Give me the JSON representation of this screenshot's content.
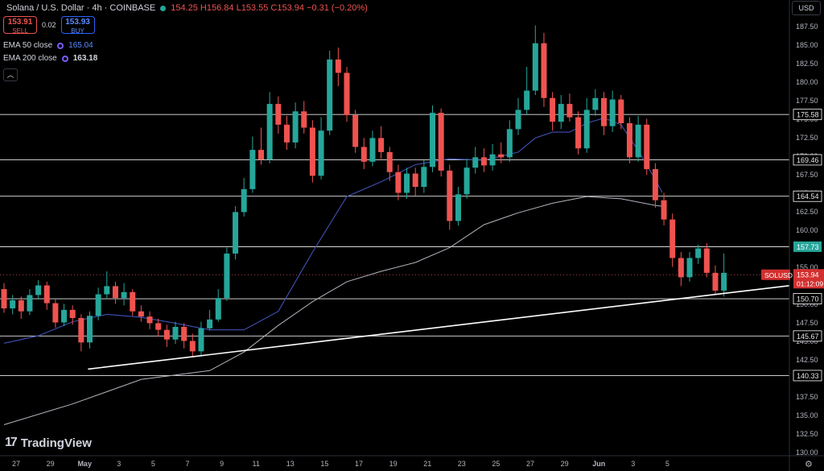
{
  "header": {
    "title": "Solana / U.S. Dollar · 4h · COINBASE",
    "ohlc": "154.25 H156.84 L153.55 C153.94 −0.31 (−0.20%)"
  },
  "trade": {
    "sell_price": "153.91",
    "sell_label": "SELL",
    "spread": "0.02",
    "buy_price": "153.93",
    "buy_label": "BUY"
  },
  "indicators": [
    {
      "name": "EMA 50 close",
      "value": "165.04",
      "color": "#3f51b5"
    },
    {
      "name": "EMA 200 close",
      "value": "163.18",
      "color": "#b2b5be"
    }
  ],
  "currency": "USD",
  "brand": "TradingView",
  "icons": [
    "settings-gear-icon",
    "collapse-chevron-icon",
    "tradingview-logo-icon"
  ],
  "colors": {
    "up": "#26a69a",
    "down": "#ef5350",
    "ema50": "#3f51b5",
    "ema200": "#b2b5be",
    "support": "#ffffff"
  },
  "chart_data": {
    "type": "candlestick",
    "symbol": "SOLUSD",
    "timeframe": "4h",
    "y_ticks": [
      "130.00",
      "132.50",
      "135.00",
      "137.50",
      "140.00",
      "142.50",
      "145.00",
      "147.50",
      "150.00",
      "152.50",
      "155.00",
      "157.50",
      "160.00",
      "162.50",
      "165.00",
      "167.50",
      "170.00",
      "172.50",
      "175.00",
      "177.50",
      "180.00",
      "182.50",
      "185.00",
      "187.50"
    ],
    "ylim": [
      129.5,
      189.5
    ],
    "x_ticks": [
      "27",
      "29",
      "May",
      "3",
      "5",
      "7",
      "9",
      "11",
      "13",
      "15",
      "17",
      "19",
      "21",
      "23",
      "25",
      "27",
      "29",
      "Jun",
      "3",
      "5"
    ],
    "price_lines": [
      {
        "label": "175.58",
        "value": 175.58,
        "highlight": false
      },
      {
        "label": "169.46",
        "value": 169.46,
        "highlight": false
      },
      {
        "label": "164.54",
        "value": 164.54,
        "highlight": false
      },
      {
        "label": "157.73",
        "value": 157.73,
        "highlight": true
      },
      {
        "label": "150.70",
        "value": 150.7,
        "highlight": false
      },
      {
        "label": "145.67",
        "value": 145.67,
        "highlight": false
      },
      {
        "label": "140.33",
        "value": 140.33,
        "highlight": false
      }
    ],
    "current": {
      "symbol": "SOLUSD",
      "price": "153.94",
      "countdown": "01:12:09",
      "value": 153.94
    },
    "trendline": {
      "from": {
        "day": 4.9,
        "price": 141.2
      },
      "to": {
        "day": 40.0,
        "price": 152.2
      }
    },
    "ema50_path": [
      [
        0,
        144.7
      ],
      [
        2,
        145.7
      ],
      [
        4,
        147.6
      ],
      [
        6,
        148.6
      ],
      [
        8,
        148.2
      ],
      [
        10,
        147.4
      ],
      [
        12,
        146.5
      ],
      [
        14,
        146.5
      ],
      [
        16,
        149.0
      ],
      [
        18,
        157.0
      ],
      [
        20,
        164.5
      ],
      [
        22,
        166.5
      ],
      [
        24,
        168.8
      ],
      [
        25,
        169.2
      ],
      [
        26,
        169.6
      ],
      [
        28,
        169.4
      ],
      [
        30,
        170.5
      ],
      [
        31,
        172.4
      ],
      [
        32,
        173.2
      ],
      [
        33,
        173.2
      ],
      [
        34,
        174.4
      ],
      [
        35,
        175.1
      ],
      [
        36,
        174.2
      ],
      [
        37,
        170.7
      ],
      [
        38,
        166.8
      ],
      [
        38.4,
        165.04
      ]
    ],
    "ema200_path": [
      [
        0,
        133.7
      ],
      [
        4,
        136.5
      ],
      [
        8,
        139.8
      ],
      [
        12,
        141.0
      ],
      [
        14,
        143.5
      ],
      [
        16,
        147.1
      ],
      [
        18,
        150.3
      ],
      [
        20,
        153.0
      ],
      [
        22,
        154.4
      ],
      [
        24,
        155.6
      ],
      [
        26,
        157.6
      ],
      [
        28,
        160.7
      ],
      [
        30,
        162.3
      ],
      [
        32,
        163.6
      ],
      [
        34,
        164.5
      ],
      [
        36,
        164.2
      ],
      [
        38,
        163.3
      ],
      [
        38.4,
        163.18
      ]
    ],
    "candles": [
      [
        0,
        152.0,
        149.4,
        152.8,
        148.8
      ],
      [
        0.5,
        149.4,
        150.5,
        151.2,
        148.6
      ],
      [
        1,
        150.5,
        149.0,
        151.0,
        148.0
      ],
      [
        1.5,
        149.0,
        151.2,
        152.0,
        148.5
      ],
      [
        2,
        151.2,
        152.5,
        153.2,
        150.6
      ],
      [
        2.5,
        152.5,
        150.1,
        153.0,
        149.2
      ],
      [
        3,
        150.1,
        147.5,
        150.6,
        146.8
      ],
      [
        3.5,
        147.5,
        149.2,
        150.0,
        147.0
      ],
      [
        4,
        149.2,
        148.1,
        149.8,
        147.2
      ],
      [
        4.5,
        148.1,
        144.8,
        148.6,
        143.6
      ],
      [
        5,
        144.8,
        148.4,
        149.0,
        144.0
      ],
      [
        5.5,
        148.4,
        151.3,
        152.2,
        147.8
      ],
      [
        6,
        151.3,
        152.4,
        154.4,
        150.8
      ],
      [
        6.5,
        152.4,
        150.8,
        153.0,
        150.0
      ],
      [
        7,
        150.8,
        151.6,
        152.8,
        149.8
      ],
      [
        7.5,
        151.6,
        149.0,
        152.0,
        148.4
      ],
      [
        8,
        149.0,
        148.3,
        149.8,
        147.6
      ],
      [
        8.5,
        148.3,
        147.4,
        149.0,
        146.6
      ],
      [
        9,
        147.4,
        146.5,
        148.0,
        145.6
      ],
      [
        9.5,
        146.5,
        145.2,
        147.2,
        144.2
      ],
      [
        10,
        145.2,
        146.9,
        147.6,
        144.6
      ],
      [
        10.5,
        146.9,
        145.0,
        147.4,
        144.0
      ],
      [
        11,
        145.0,
        143.6,
        146.0,
        142.8
      ],
      [
        11.5,
        143.6,
        146.7,
        147.6,
        143.0
      ],
      [
        12,
        146.7,
        147.9,
        149.2,
        146.4
      ],
      [
        12.5,
        147.9,
        150.8,
        152.0,
        147.6
      ],
      [
        13,
        150.8,
        156.8,
        157.6,
        150.4
      ],
      [
        13.5,
        156.8,
        162.4,
        163.2,
        156.0
      ],
      [
        14,
        162.4,
        165.5,
        167.0,
        161.8
      ],
      [
        14.5,
        165.5,
        170.8,
        172.6,
        165.0
      ],
      [
        15,
        170.8,
        169.5,
        173.8,
        168.8
      ],
      [
        15.5,
        169.5,
        177.0,
        178.6,
        169.0
      ],
      [
        16,
        177.0,
        174.2,
        178.0,
        173.0
      ],
      [
        16.5,
        174.2,
        171.8,
        175.4,
        170.8
      ],
      [
        17,
        171.8,
        176.0,
        177.2,
        171.0
      ],
      [
        17.5,
        176.0,
        173.8,
        177.4,
        173.0
      ],
      [
        18,
        173.8,
        167.3,
        174.8,
        166.4
      ],
      [
        18.5,
        167.3,
        173.4,
        175.2,
        166.8
      ],
      [
        19,
        173.4,
        183.0,
        184.2,
        172.8
      ],
      [
        19.5,
        183.0,
        181.2,
        184.6,
        179.4
      ],
      [
        20,
        181.2,
        175.5,
        182.0,
        174.6
      ],
      [
        20.5,
        175.5,
        171.2,
        176.2,
        170.4
      ],
      [
        21,
        171.2,
        169.2,
        172.4,
        168.2
      ],
      [
        21.5,
        169.2,
        172.4,
        173.4,
        168.6
      ],
      [
        22,
        172.4,
        170.5,
        174.0,
        169.6
      ],
      [
        22.5,
        170.5,
        167.8,
        171.2,
        166.6
      ],
      [
        23,
        167.8,
        165.0,
        168.8,
        164.0
      ],
      [
        23.5,
        165.0,
        167.6,
        168.4,
        164.2
      ],
      [
        24,
        167.6,
        165.8,
        168.4,
        164.6
      ],
      [
        24.5,
        165.8,
        168.5,
        169.4,
        165.0
      ],
      [
        25,
        168.5,
        175.8,
        176.8,
        167.8
      ],
      [
        25.5,
        175.8,
        168.0,
        176.4,
        167.2
      ],
      [
        26,
        168.0,
        161.2,
        168.8,
        160.0
      ],
      [
        26.5,
        161.2,
        164.8,
        165.8,
        160.6
      ],
      [
        27,
        164.8,
        168.4,
        169.6,
        164.2
      ],
      [
        27.5,
        168.4,
        169.8,
        171.2,
        167.6
      ],
      [
        28,
        169.8,
        168.7,
        171.0,
        167.8
      ],
      [
        28.5,
        168.7,
        170.2,
        171.6,
        168.0
      ],
      [
        29,
        170.2,
        169.8,
        171.8,
        169.0
      ],
      [
        29.5,
        169.8,
        173.6,
        174.8,
        169.2
      ],
      [
        30,
        173.6,
        176.2,
        177.8,
        172.8
      ],
      [
        30.5,
        176.2,
        178.8,
        182.0,
        175.6
      ],
      [
        31,
        178.8,
        185.2,
        187.6,
        178.2
      ],
      [
        31.5,
        185.2,
        177.8,
        186.6,
        176.6
      ],
      [
        32,
        177.8,
        174.6,
        178.6,
        173.4
      ],
      [
        32.5,
        174.6,
        177.0,
        178.2,
        173.6
      ],
      [
        33,
        177.0,
        175.2,
        178.4,
        174.6
      ],
      [
        33.5,
        175.2,
        171.0,
        176.0,
        170.2
      ],
      [
        34,
        171.0,
        176.2,
        177.8,
        170.4
      ],
      [
        34.5,
        176.2,
        177.8,
        179.0,
        175.4
      ],
      [
        35,
        177.8,
        174.0,
        178.6,
        172.8
      ],
      [
        35.5,
        174.0,
        177.6,
        178.8,
        173.2
      ],
      [
        36,
        177.6,
        174.4,
        178.2,
        173.6
      ],
      [
        36.5,
        174.4,
        169.8,
        175.2,
        169.0
      ],
      [
        37,
        169.8,
        174.2,
        175.4,
        169.2
      ],
      [
        37.5,
        174.2,
        168.2,
        175.0,
        167.4
      ],
      [
        38,
        168.2,
        164.0,
        169.0,
        163.0
      ],
      [
        38.5,
        164.0,
        161.4,
        165.0,
        160.6
      ],
      [
        39,
        161.4,
        156.2,
        162.2,
        155.0
      ],
      [
        39.5,
        156.2,
        153.6,
        157.0,
        152.4
      ],
      [
        40,
        153.6,
        156.2,
        157.0,
        153.0
      ],
      [
        40.5,
        156.2,
        157.5,
        158.0,
        155.4
      ],
      [
        41,
        157.5,
        154.2,
        158.2,
        153.6
      ],
      [
        41.5,
        154.2,
        151.8,
        155.2,
        151.2
      ],
      [
        42,
        151.8,
        154.2,
        156.8,
        151.0
      ]
    ]
  }
}
